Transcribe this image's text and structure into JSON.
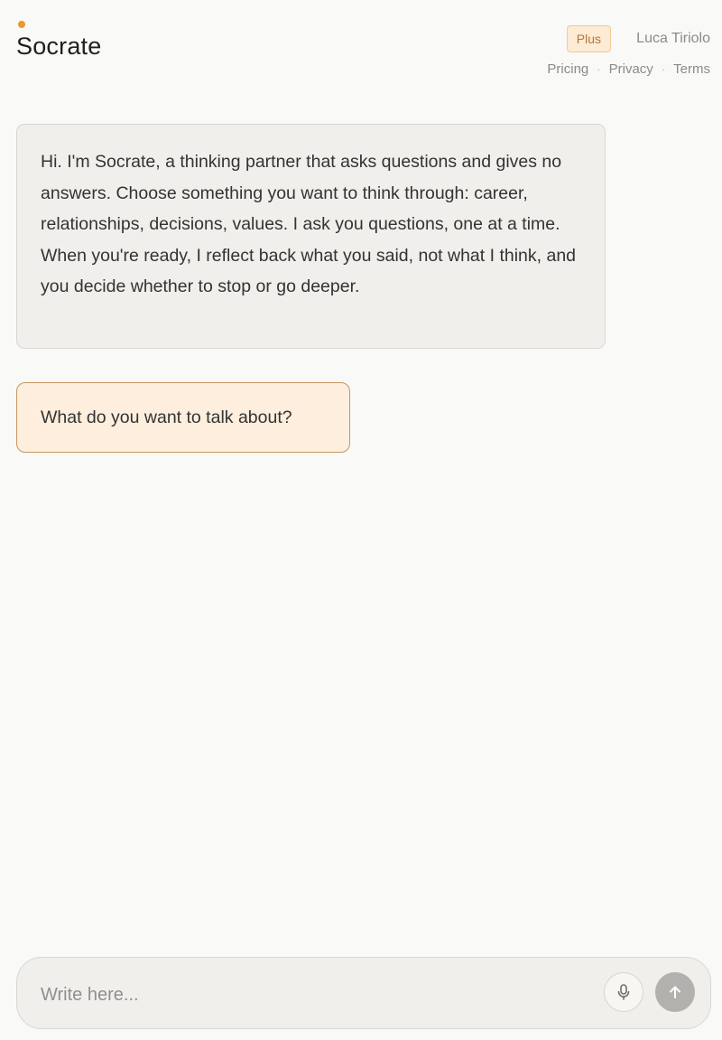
{
  "header": {
    "brand_title": "Socrate",
    "brand_dot_color": "#ee9632",
    "plan_badge": "Plus",
    "user_name": "Luca Tiriolo",
    "links": [
      {
        "label": "Pricing"
      },
      {
        "label": "Privacy"
      },
      {
        "label": "Terms"
      }
    ],
    "link_separator": "·"
  },
  "messages": [
    {
      "role": "assistant-intro",
      "text": "Hi. I'm Socrate, a thinking partner that asks questions and gives no answers. Choose something you want to think through: career, relationships, decisions, values. I ask you questions, one at a time. When you're ready, I reflect back what you said, not what I think, and you decide whether to stop or go deeper."
    },
    {
      "role": "assistant-question",
      "text": "What do you want to talk about?"
    }
  ],
  "composer": {
    "placeholder": "Write here...",
    "value": "",
    "mic_icon": "microphone-icon",
    "send_icon": "arrow-up-icon"
  },
  "colors": {
    "accent": "#ee9632",
    "question_bubble_bg": "#fdeedd",
    "question_bubble_border": "#c89560",
    "intro_bubble_bg": "#f0efeb"
  }
}
